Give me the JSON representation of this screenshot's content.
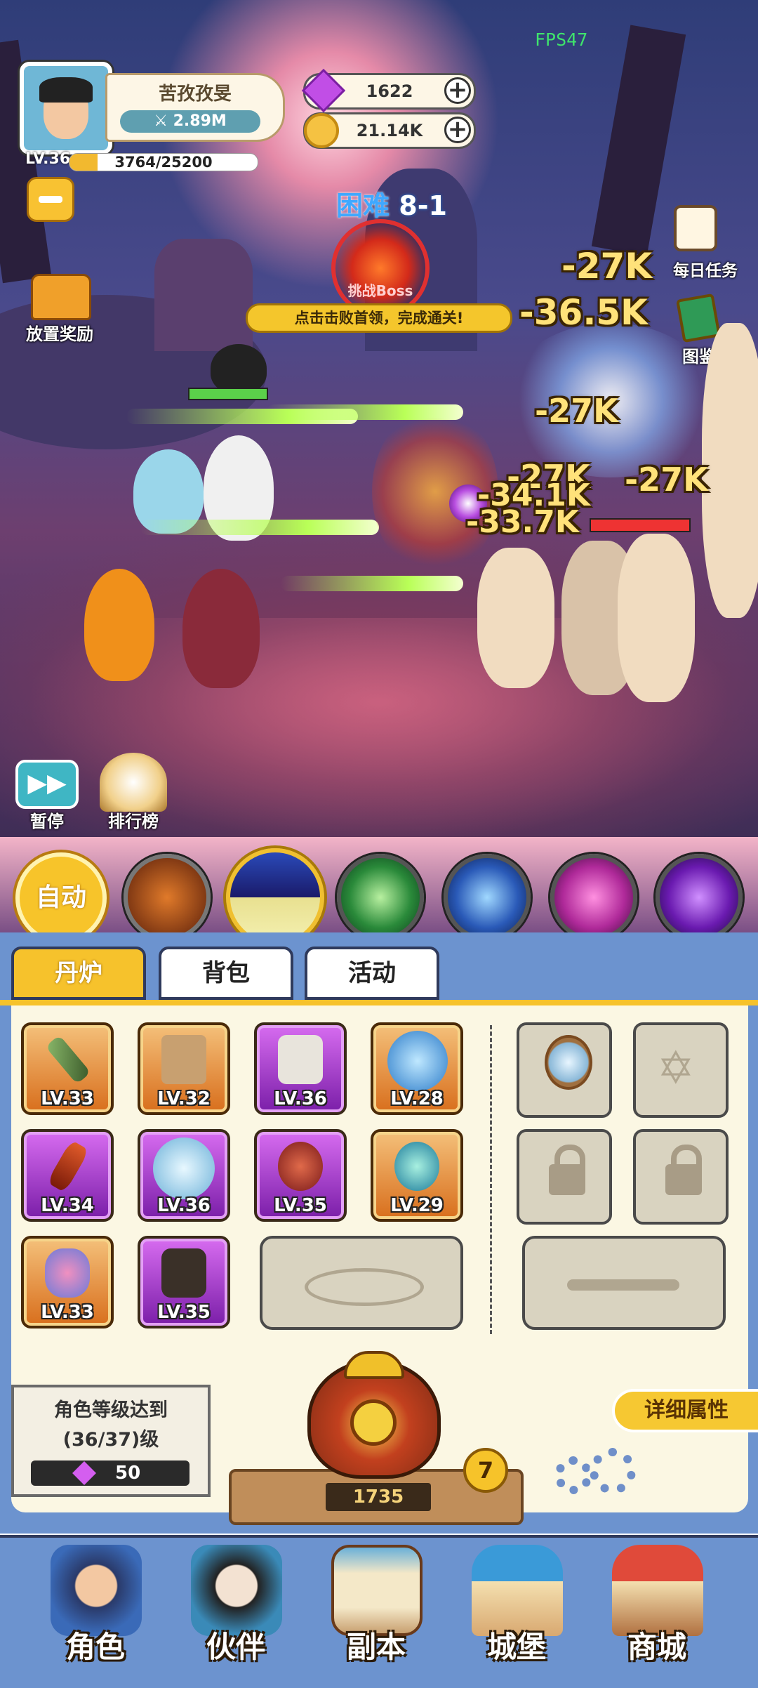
{
  "hud": {
    "fps": "FPS47",
    "player_name": "苦孜孜旻",
    "power": "2.89M",
    "level": "LV.36",
    "xp_text": "3764/25200",
    "xp_progress": 0.149,
    "gems": "1622",
    "coins": "21.14K"
  },
  "side_left": {
    "idle_reward": "放置奖励"
  },
  "stage": {
    "difficulty": "困难",
    "number": "8-1",
    "boss_label": "挑战Boss",
    "hint": "点击击败首领，完成通关!"
  },
  "side_right": {
    "daily_tasks": "每日任务",
    "codex": "图鉴"
  },
  "damage_numbers": [
    "-27K",
    "-36.5K",
    "-27K",
    "-27K",
    "-27K",
    "-34.1K",
    "-33.7K"
  ],
  "battle_controls": {
    "pause": "暂停",
    "pause_icon": "▶▶",
    "leaderboard": "排行榜"
  },
  "skills": {
    "auto": "自动"
  },
  "tabs": [
    "丹炉",
    "背包",
    "活动"
  ],
  "inventory": {
    "items": [
      {
        "level": "LV.33",
        "rarity": "orange",
        "icon": "sword-icon"
      },
      {
        "level": "LV.32",
        "rarity": "orange",
        "icon": "banner-icon"
      },
      {
        "level": "LV.36",
        "rarity": "purple",
        "icon": "robe-icon"
      },
      {
        "level": "LV.28",
        "rarity": "orange",
        "icon": "orb-icon"
      },
      {
        "level": "LV.34",
        "rarity": "purple",
        "icon": "blade-icon"
      },
      {
        "level": "LV.36",
        "rarity": "purple",
        "icon": "swirl-orb-icon"
      },
      {
        "level": "LV.35",
        "rarity": "purple",
        "icon": "gourd-icon"
      },
      {
        "level": "LV.29",
        "rarity": "orange",
        "icon": "water-orb-icon"
      },
      {
        "level": "LV.33",
        "rarity": "orange",
        "icon": "charm-icon"
      },
      {
        "level": "LV.35",
        "rarity": "purple",
        "icon": "boots-icon"
      }
    ]
  },
  "requirement": {
    "line1": "角色等级达到",
    "line2": "(36/37)级",
    "cost": "50"
  },
  "furnace": {
    "value": "1735",
    "badge": "7"
  },
  "detail_button": "详细属性",
  "bottom_nav": [
    "角色",
    "伙伴",
    "副本",
    "城堡",
    "商城"
  ],
  "colors": {
    "panel_blue": "#6c93cf",
    "gold": "#f6c832",
    "orange_rarity": "#d86e1c",
    "purple_rarity": "#7a1ea8"
  }
}
